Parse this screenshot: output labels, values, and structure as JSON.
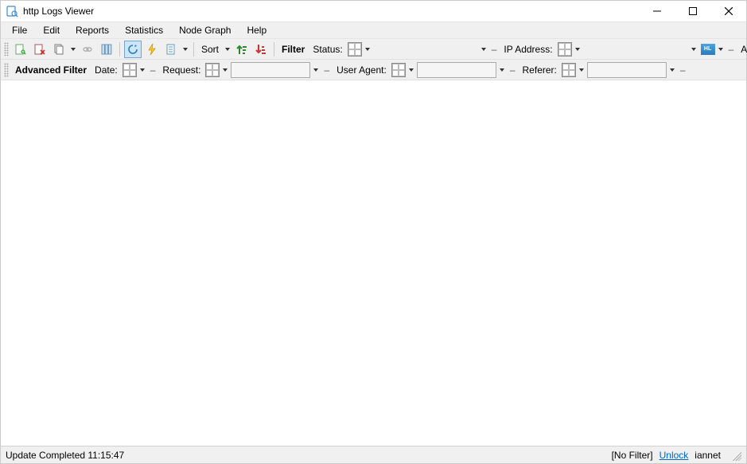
{
  "title": "http Logs Viewer",
  "menubar": [
    "File",
    "Edit",
    "Reports",
    "Statistics",
    "Node Graph",
    "Help"
  ],
  "toolbar1": {
    "sort_label": "Sort",
    "filter_label": "Filter",
    "status_label": "Status:",
    "ip_label": "IP Address:",
    "all_label": "All",
    "status_value": "",
    "ip_value": ""
  },
  "toolbar2": {
    "advanced_filter_label": "Advanced Filter",
    "date_label": "Date:",
    "request_label": "Request:",
    "user_agent_label": "User Agent:",
    "referer_label": "Referer:",
    "date_value": "",
    "request_value": "",
    "user_agent_value": "",
    "referer_value": ""
  },
  "statusbar": {
    "message": "Update Completed 11:15:47",
    "filter_status": "[No Filter]",
    "unlock": "Unlock",
    "user": "iannet"
  }
}
